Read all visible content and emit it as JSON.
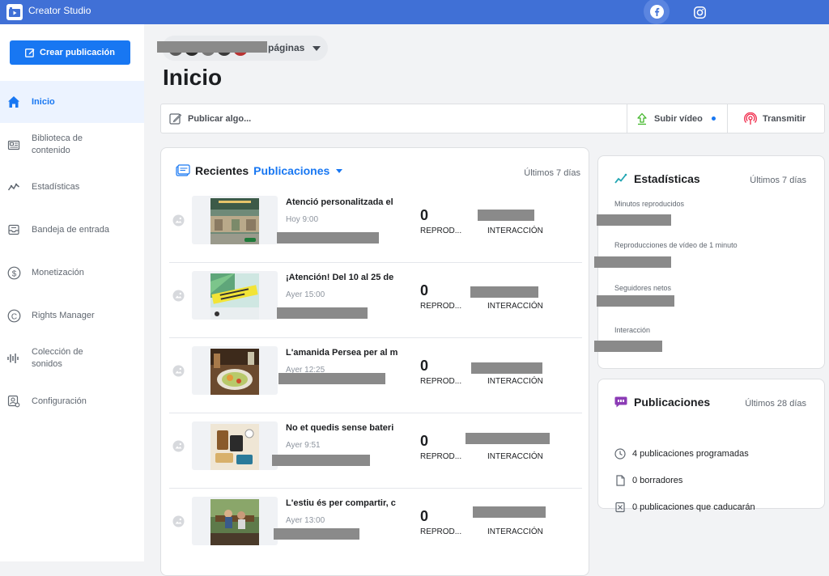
{
  "app": {
    "title": "Creator Studio"
  },
  "sidebar": {
    "create_label": "Crear publicación",
    "items": [
      {
        "label": "Inicio",
        "icon": "home-icon",
        "active": true
      },
      {
        "label": "Biblioteca de\ncontenido",
        "icon": "library-icon"
      },
      {
        "label": "Estadísticas",
        "icon": "insights-icon"
      },
      {
        "label": "Bandeja de entrada",
        "icon": "inbox-icon"
      },
      {
        "label": "Monetización",
        "icon": "dollar-icon"
      },
      {
        "label": "Rights Manager",
        "icon": "copyright-icon"
      },
      {
        "label": "Colección de\nsonidos",
        "icon": "sound-icon"
      },
      {
        "label": "Configuración",
        "icon": "settings-icon"
      }
    ]
  },
  "page_selector": {
    "label": "páginas"
  },
  "page": {
    "title": "Inicio"
  },
  "composer": {
    "placeholder": "Publicar algo...",
    "upload_label": "Subir vídeo",
    "live_label": "Transmitir"
  },
  "recent": {
    "title": "Recientes",
    "dropdown": "Publicaciones",
    "range": "Últimos 7 días",
    "posts": [
      {
        "title": "Atenció personalitzada el",
        "time": "Hoy 9:00",
        "plays": "0",
        "plays_label": "REPROD...",
        "inter_label": "INTERACCIÓN",
        "thumb": "shop"
      },
      {
        "title": "¡Atención! Del 10 al 25 de",
        "time": "Ayer 15:00",
        "plays": "0",
        "plays_label": "REPROD...",
        "inter_label": "INTERACCIÓN",
        "thumb": "promo"
      },
      {
        "title": "L'amanida Persea per al m",
        "time": "Ayer 12:25",
        "plays": "0",
        "plays_label": "REPROD...",
        "inter_label": "INTERACCIÓN",
        "thumb": "food"
      },
      {
        "title": "No et quedis sense bateri",
        "time": "Ayer 9:51",
        "plays": "0",
        "plays_label": "REPROD...",
        "inter_label": "INTERACCIÓN",
        "thumb": "battery"
      },
      {
        "title": "L'estiu és per compartir, c",
        "time": "Ayer 13:00",
        "plays": "0",
        "plays_label": "REPROD...",
        "inter_label": "INTERACCIÓN",
        "thumb": "garden"
      }
    ]
  },
  "stats": {
    "title": "Estadísticas",
    "range": "Últimos 7 días",
    "items": [
      {
        "label": "Minutos reproducidos"
      },
      {
        "label": "Reproducciones de vídeo de 1 minuto"
      },
      {
        "label": "Seguidores netos"
      },
      {
        "label": "Interacción"
      }
    ]
  },
  "publications": {
    "title": "Publicaciones",
    "range": "Últimos 28 días",
    "items": [
      {
        "label": "4 publicaciones programadas",
        "icon": "clock-icon"
      },
      {
        "label": "0 borradores",
        "icon": "draft-icon"
      },
      {
        "label": "0 publicaciones que caducarán",
        "icon": "expire-icon"
      }
    ]
  },
  "colors": {
    "topbar": "#4070d6",
    "accent": "#1877f2",
    "sidebar_active_bg": "#ecf3ff"
  }
}
